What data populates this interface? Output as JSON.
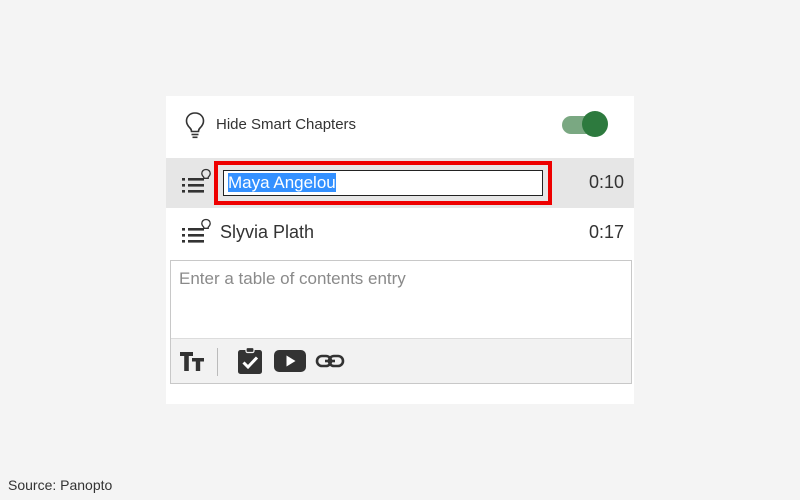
{
  "panel": {
    "toggle": {
      "label": "Hide Smart Chapters",
      "icon": "lightbulb-icon",
      "state": "on",
      "color": "#2d7a3e"
    },
    "chapters": [
      {
        "title": "Maya Angelou",
        "time": "0:10",
        "icon": "smart-chapter-list-icon",
        "selected": true,
        "editing": true
      },
      {
        "title": "Slyvia Plath",
        "time": "0:17",
        "icon": "smart-chapter-list-icon",
        "selected": false,
        "editing": false
      }
    ],
    "entry": {
      "placeholder": "Enter a table of contents entry",
      "toolbar": [
        {
          "name": "text-format-icon"
        },
        {
          "name": "checklist-icon"
        },
        {
          "name": "video-icon"
        },
        {
          "name": "link-icon"
        }
      ]
    }
  },
  "source": "Source: Panopto",
  "colors": {
    "highlight_box": "#ee0000",
    "selection": "#3390ff",
    "row_selected": "#e6e6e6"
  }
}
